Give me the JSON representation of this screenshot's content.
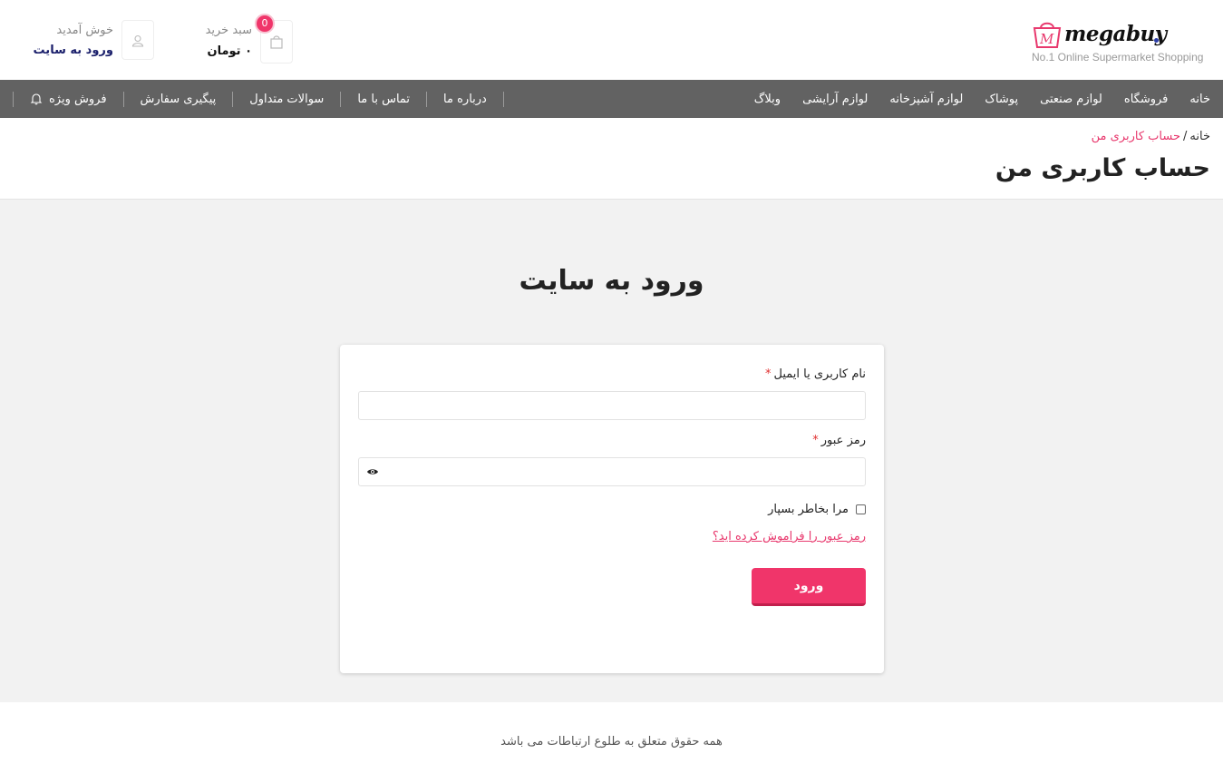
{
  "header": {
    "logo": {
      "word": "megabuy",
      "tagline": "No.1 Online Supermarket Shopping"
    },
    "cart": {
      "title": "سبد خرید",
      "amount": "۰ تومان",
      "count": "0"
    },
    "user": {
      "greeting": "خوش آمدید",
      "login_link": "ورود به سایت"
    }
  },
  "nav": {
    "main_items": [
      "خانه",
      "فروشگاه",
      "لوازم صنعتی",
      "پوشاک",
      "لوازم آشپزخانه",
      "لوازم آرایشی",
      "وبلاگ"
    ],
    "secondary_items": [
      "درباره ما",
      "تماس با ما",
      "سوالات متداول",
      "پیگیری سفارش",
      "فروش ویژه"
    ]
  },
  "breadcrumb": {
    "home": "خانه",
    "separator": "/",
    "current": "حساب کاربری من"
  },
  "page_title": "حساب کاربری من",
  "login": {
    "heading": "ورود به سایت",
    "username_label": "نام کاربری یا ایمیل",
    "password_label": "رمز عبور",
    "required_mark": "*",
    "username_value": "",
    "password_value": "",
    "remember_label": "مرا بخاطر بسپار",
    "forgot_link": "رمز عبور را فراموش کرده اید؟",
    "submit_label": "ورود"
  },
  "footer": {
    "copyright": "همه حقوق متعلق به طلوع ارتباطات می باشد"
  },
  "colors": {
    "accent": "#f0356a",
    "nav_bg": "#626262",
    "page_bg": "#f2f2f2",
    "link_dark": "#1a1f6b"
  }
}
